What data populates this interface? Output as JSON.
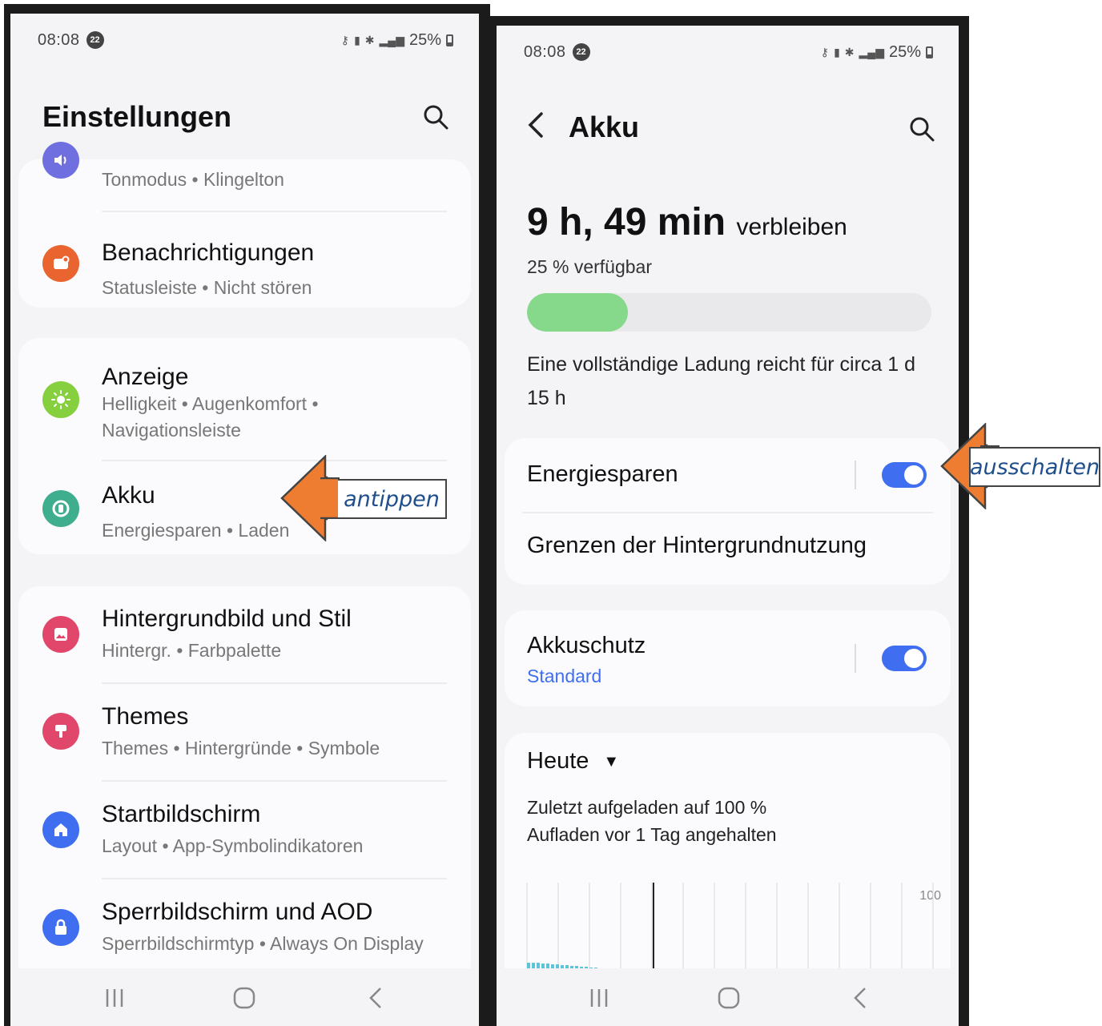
{
  "left_screen": {
    "status": {
      "time": "08:08",
      "notification_count": "22",
      "battery": "25%"
    },
    "title": "Einstellungen",
    "items": [
      {
        "title": "",
        "sub": "Tonmodus  •  Klingelton",
        "icon": "volume-icon",
        "color": "#6f6fe0"
      },
      {
        "title": "Benachrichtigungen",
        "sub": "Statusleiste  •  Nicht stören",
        "icon": "notification-icon",
        "color": "#e9642f"
      },
      {
        "title": "Anzeige",
        "sub": "Helligkeit  •  Augenkomfort  •  Navigationsleiste",
        "icon": "display-icon",
        "color": "#86cf3e"
      },
      {
        "title": "Akku",
        "sub": "Energiesparen  •  Laden",
        "icon": "battery-icon",
        "color": "#3fae8e"
      },
      {
        "title": "Hintergrundbild und Stil",
        "sub": "Hintergr.  •  Farbpalette",
        "icon": "wallpaper-icon",
        "color": "#e0476b"
      },
      {
        "title": "Themes",
        "sub": "Themes  •  Hintergründe  •  Symbole",
        "icon": "themes-icon",
        "color": "#e0476b"
      },
      {
        "title": "Startbildschirm",
        "sub": "Layout  •  App-Symbolindikatoren",
        "icon": "home-icon",
        "color": "#3f6ff0"
      },
      {
        "title": "Sperrbildschirm und AOD",
        "sub": "Sperrbildschirmtyp  •  Always On Display",
        "icon": "lock-icon",
        "color": "#3f6ff0"
      }
    ],
    "callout": "antippen"
  },
  "right_screen": {
    "status": {
      "time": "08:08",
      "notification_count": "22",
      "battery": "25%"
    },
    "title": "Akku",
    "remaining": "9 h, 49 min",
    "remaining_suffix": "verbleiben",
    "available": "25 % verfügbar",
    "battery_level": 0.25,
    "full_charge": "Eine vollständige Ladung reicht für circa 1 d 15 h",
    "energy_saving": {
      "label": "Energiesparen",
      "on": true
    },
    "background_limits": "Grenzen der Hintergrundnutzung",
    "battery_protection": {
      "label": "Akkuschutz",
      "value": "Standard",
      "on": true
    },
    "period": "Heute",
    "last_charged": "Zuletzt aufgeladen auf 100 %",
    "charging_paused": "Aufladen vor 1 Tag angehalten",
    "chart_axis_max": "100",
    "callout": "ausschalten"
  },
  "colors": {
    "accent": "#3f6ff0",
    "callout_arrow": "#ee7d31",
    "battery_fill": "#86d98b"
  }
}
